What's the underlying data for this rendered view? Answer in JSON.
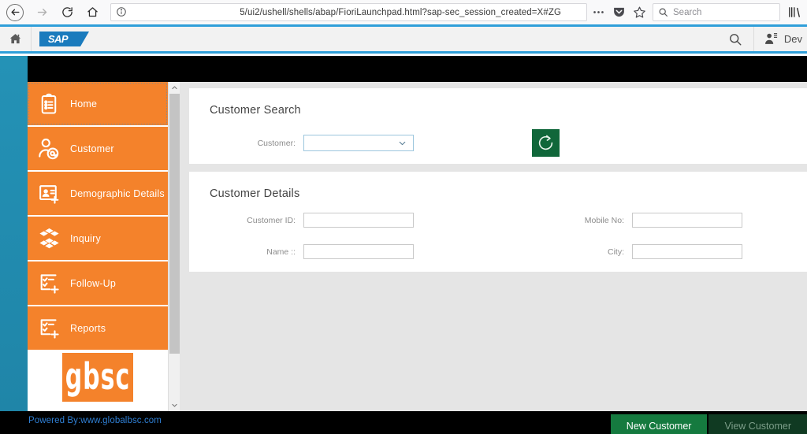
{
  "browser": {
    "back_icon": "back-arrow-icon",
    "forward_icon": "forward-arrow-icon",
    "reload_icon": "reload-icon",
    "home_icon": "home-icon",
    "url": "5/ui2/ushell/shells/abap/FioriLaunchpad.html?sap-sec_session_created=X#ZG",
    "page_info_icon": "page-info-icon",
    "more_icon": "ellipsis-icon",
    "pocket_icon": "pocket-shield-icon",
    "bookmark_icon": "star-icon",
    "search_placeholder": "Search",
    "search_icon": "search-icon",
    "library_icon": "library-icon"
  },
  "sap_header": {
    "home_icon": "home-icon",
    "logo_text": "SAP",
    "search_icon": "search-icon",
    "user_icon": "user-icon",
    "user_name": "Dev"
  },
  "sidebar": {
    "items": [
      {
        "label": "Home",
        "icon": "clipboard-list-icon",
        "selected": true
      },
      {
        "label": "Customer",
        "icon": "user-at-icon",
        "selected": false
      },
      {
        "label": "Demographic Details",
        "icon": "contact-card-plus-icon",
        "selected": false
      },
      {
        "label": "Inquiry",
        "icon": "cube-cluster-icon",
        "selected": false
      },
      {
        "label": "Follow-Up",
        "icon": "checklist-plus-icon",
        "selected": false
      },
      {
        "label": "Reports",
        "icon": "checklist-plus-icon",
        "selected": false
      }
    ],
    "brand_logo_text": "gbsc",
    "scrollbar": {
      "up_icon": "chevron-up-icon",
      "down_icon": "chevron-down-icon"
    }
  },
  "main": {
    "search_panel": {
      "title": "Customer Search",
      "customer_label": "Customer:",
      "customer_value": "",
      "dropdown_icon": "chevron-down-icon",
      "refresh_icon": "refresh-icon",
      "refresh_color": "#10673a"
    },
    "details_panel": {
      "title": "Customer Details",
      "fields": [
        {
          "label": "Customer ID:",
          "value": ""
        },
        {
          "label": "Mobile No:",
          "value": ""
        },
        {
          "label": "Name ::",
          "value": ""
        },
        {
          "label": "City:",
          "value": ""
        }
      ]
    }
  },
  "footer": {
    "powered_by": "Powered By:www.globalbsc.com",
    "powered_by_color": "#2f7fd4",
    "new_customer_label": "New Customer",
    "view_customer_label": "View Customer"
  }
}
